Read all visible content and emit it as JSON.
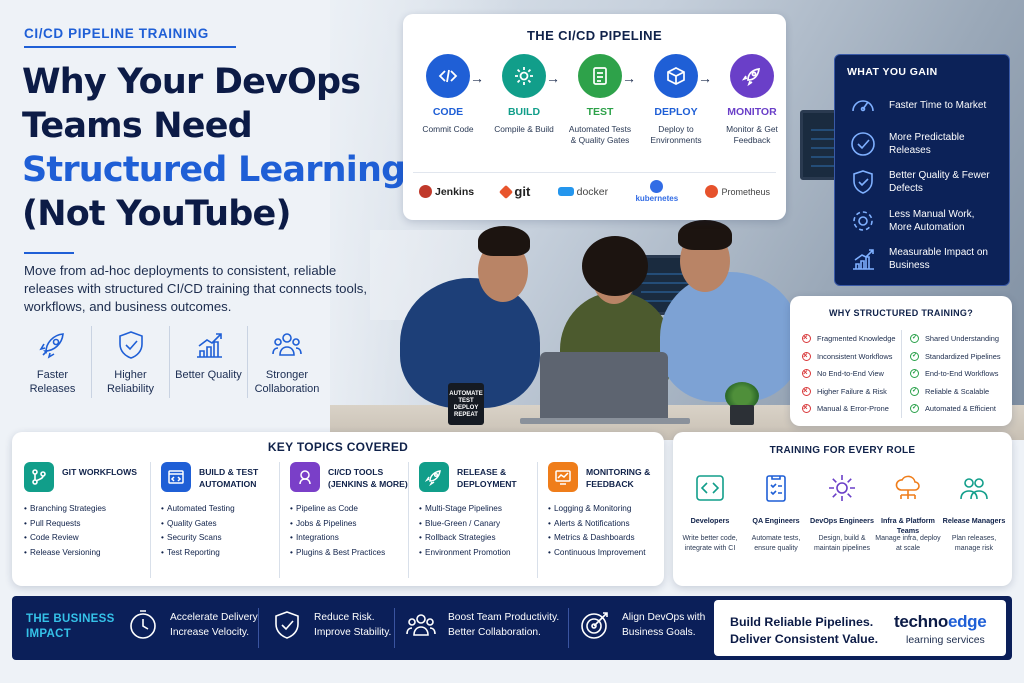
{
  "header": {
    "eyebrow": "CI/CD PIPELINE TRAINING",
    "title_line1": "Why Your DevOps",
    "title_line2": "Teams Need",
    "title_line3": "Structured Learning",
    "title_line4": "(Not YouTube)",
    "lead": "Move from ad-hoc deployments to consistent, reliable releases with structured CI/CD training that connects tools, workflows, and business outcomes."
  },
  "benefits": [
    {
      "icon": "rocket-icon",
      "label": "Faster Releases"
    },
    {
      "icon": "shield-check-icon",
      "label": "Higher Reliability"
    },
    {
      "icon": "bar-chart-icon",
      "label": "Better Quality"
    },
    {
      "icon": "team-icon",
      "label": "Stronger Collaboration"
    }
  ],
  "pipeline": {
    "title": "THE CI/CD PIPELINE",
    "arrow": "→",
    "stages": [
      {
        "name": "CODE",
        "desc": "Commit Code",
        "icon": "code-icon",
        "color": "#1f5fd6"
      },
      {
        "name": "BUILD",
        "desc": "Compile & Build",
        "icon": "gear-icon",
        "color": "#119e8a"
      },
      {
        "name": "TEST",
        "desc": "Automated Tests & Quality Gates",
        "icon": "checklist-icon",
        "color": "#2ea24a"
      },
      {
        "name": "DEPLOY",
        "desc": "Deploy to Environments",
        "icon": "package-icon",
        "color": "#1f5fd6"
      },
      {
        "name": "MONITOR",
        "desc": "Monitor & Get Feedback",
        "icon": "rocket-icon",
        "color": "#6a3fc8"
      }
    ],
    "tools": [
      {
        "name": "Jenkins",
        "color": "#c0392b"
      },
      {
        "name": "git",
        "color": "#e8552d"
      },
      {
        "name": "docker",
        "color": "#2496ed"
      },
      {
        "name": "kubernetes",
        "color": "#326ce5"
      },
      {
        "name": "Prometheus",
        "color": "#e6522c"
      }
    ]
  },
  "mug_text": "AUTOMATE TEST DEPLOY REPEAT",
  "gains": {
    "title": "WHAT YOU GAIN",
    "items": [
      {
        "icon": "speedometer-icon",
        "label": "Faster Time to Market"
      },
      {
        "icon": "check-circle-icon",
        "label": "More Predictable Releases"
      },
      {
        "icon": "shield-check-icon",
        "label": "Better Quality & Fewer Defects"
      },
      {
        "icon": "gear-icon",
        "label": "Less Manual Work, More Automation"
      },
      {
        "icon": "growth-chart-icon",
        "label": "Measurable Impact on Business"
      }
    ]
  },
  "why": {
    "title": "WHY STRUCTURED TRAINING?",
    "problems": [
      "Fragmented Knowledge",
      "Inconsistent Workflows",
      "No End-to-End View",
      "Higher Failure & Risk",
      "Manual & Error-Prone"
    ],
    "solutions": [
      "Shared Understanding",
      "Standardized Pipelines",
      "End-to-End Workflows",
      "Reliable & Scalable",
      "Automated & Efficient"
    ]
  },
  "topics": {
    "title": "KEY TOPICS COVERED",
    "columns": [
      {
        "title": "GIT WORKFLOWS",
        "icon": "branch-icon",
        "color": "#119e8a",
        "items": [
          "Branching Strategies",
          "Pull Requests",
          "Code Review",
          "Release Versioning"
        ]
      },
      {
        "title": "BUILD & TEST AUTOMATION",
        "icon": "code-window-icon",
        "color": "#1f5fd6",
        "items": [
          "Automated Testing",
          "Quality Gates",
          "Security Scans",
          "Test Reporting"
        ]
      },
      {
        "title": "CI/CD TOOLS (JENKINS & MORE)",
        "icon": "jenkins-icon",
        "color": "#7a3fc8",
        "items": [
          "Pipeline as Code",
          "Jobs & Pipelines",
          "Integrations",
          "Plugins & Best Practices"
        ]
      },
      {
        "title": "RELEASE & DEPLOYMENT",
        "icon": "rocket-icon",
        "color": "#119e8a",
        "items": [
          "Multi-Stage Pipelines",
          "Blue-Green / Canary",
          "Rollback Strategies",
          "Environment Promotion"
        ]
      },
      {
        "title": "MONITORING & FEEDBACK",
        "icon": "monitor-chart-icon",
        "color": "#ef7d1a",
        "items": [
          "Logging & Monitoring",
          "Alerts & Notifications",
          "Metrics & Dashboards",
          "Continuous Improvement"
        ]
      }
    ]
  },
  "roles": {
    "title": "TRAINING FOR EVERY ROLE",
    "items": [
      {
        "title": "Developers",
        "desc": "Write better code, integrate with CI",
        "icon": "code-icon",
        "color": "#119e8a"
      },
      {
        "title": "QA Engineers",
        "desc": "Automate tests, ensure quality",
        "icon": "checklist-icon",
        "color": "#1f5fd6"
      },
      {
        "title": "DevOps Engineers",
        "desc": "Design, build & maintain pipelines",
        "icon": "gear-icon",
        "color": "#6a3fc8"
      },
      {
        "title": "Infra & Platform Teams",
        "desc": "Manage infra, deploy at scale",
        "icon": "cloud-icon",
        "color": "#ef7d1a"
      },
      {
        "title": "Release Managers",
        "desc": "Plan releases, manage risk",
        "icon": "team-icon",
        "color": "#119e8a"
      }
    ]
  },
  "impact": {
    "label_line1": "THE BUSINESS",
    "label_line2": "IMPACT",
    "items": [
      {
        "icon": "clock-icon",
        "line1": "Accelerate Delivery.",
        "line2": "Increase Velocity."
      },
      {
        "icon": "shield-check-icon",
        "line1": "Reduce Risk.",
        "line2": "Improve Stability."
      },
      {
        "icon": "team-icon",
        "line1": "Boost Team Productivity.",
        "line2": "Better Collaboration."
      },
      {
        "icon": "target-icon",
        "line1": "Align DevOps with",
        "line2": "Business Goals."
      }
    ],
    "tagline_line1": "Build Reliable Pipelines.",
    "tagline_line2": "Deliver Consistent Value.",
    "brand_part1": "techno",
    "brand_part2": "edge",
    "brand_sub": "learning services"
  }
}
